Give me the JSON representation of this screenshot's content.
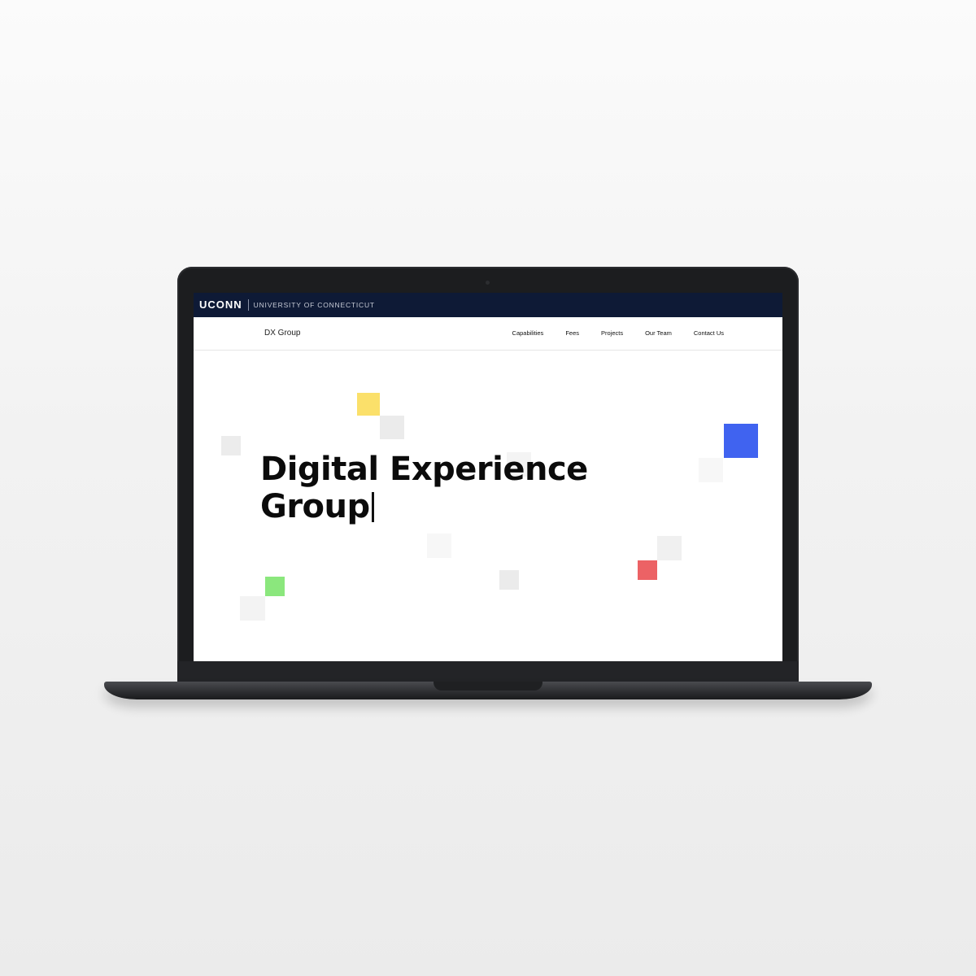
{
  "uconn_bar": {
    "logo": "UCONN",
    "name": "UNIVERSITY OF CONNECTICUT"
  },
  "header": {
    "brand": "DX Group",
    "nav": [
      "Capabilities",
      "Fees",
      "Projects",
      "Our Team",
      "Contact Us"
    ]
  },
  "hero": {
    "line1": "Digital Experience",
    "line2": "Group"
  },
  "colors": {
    "uconn_navy": "#0e1a36",
    "yellow": "#fbe06a",
    "blue": "#4063f0",
    "green": "#8be77d",
    "red": "#ec6265",
    "light_gray": "#ececec"
  }
}
